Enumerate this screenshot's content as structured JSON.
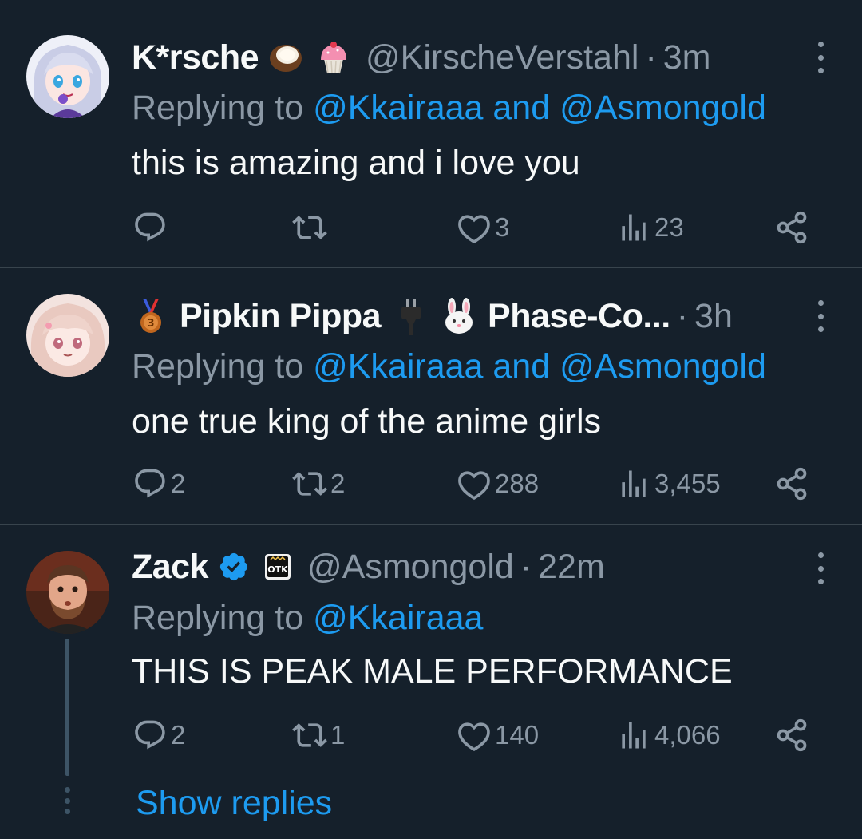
{
  "tweets": [
    {
      "name": "K*rsche",
      "emojis": [
        "coconut-emoji",
        "cupcake-emoji"
      ],
      "handle": "@KirscheVerstahl",
      "dot": "·",
      "time": "3m",
      "replying_prefix": "Replying to ",
      "replying_targets": "@Kkairaaa and @Asmongold",
      "text": "this is amazing and i love you",
      "reply_count": "",
      "retweet_count": "",
      "like_count": "3",
      "view_count": "23"
    },
    {
      "name": "Pipkin Pippa",
      "name_suffix": "Phase-Co...",
      "emojis": [
        "medal-emoji",
        "plug-emoji",
        "rabbit-emoji"
      ],
      "dot": "·",
      "time": "3h",
      "replying_prefix": "Replying to ",
      "replying_targets": "@Kkairaaa and @Asmongold",
      "text": "one true king of the anime girls",
      "reply_count": "2",
      "retweet_count": "2",
      "like_count": "288",
      "view_count": "3,455"
    },
    {
      "name": "Zack",
      "emojis": [
        "verified-badge-icon",
        "otk-badge-icon"
      ],
      "otk_label": "OTK",
      "handle": "@Asmongold",
      "dot": "·",
      "time": "22m",
      "replying_prefix": "Replying to ",
      "replying_targets": "@Kkairaaa",
      "text": "THIS IS PEAK MALE PERFORMANCE",
      "reply_count": "2",
      "retweet_count": "1",
      "like_count": "140",
      "view_count": "4,066"
    }
  ],
  "show_replies": "Show replies",
  "colors": {
    "background": "#15202b",
    "text": "#f7f9f9",
    "secondary": "#8b98a5",
    "accent": "#1d9bf0",
    "divider": "#38444d"
  }
}
